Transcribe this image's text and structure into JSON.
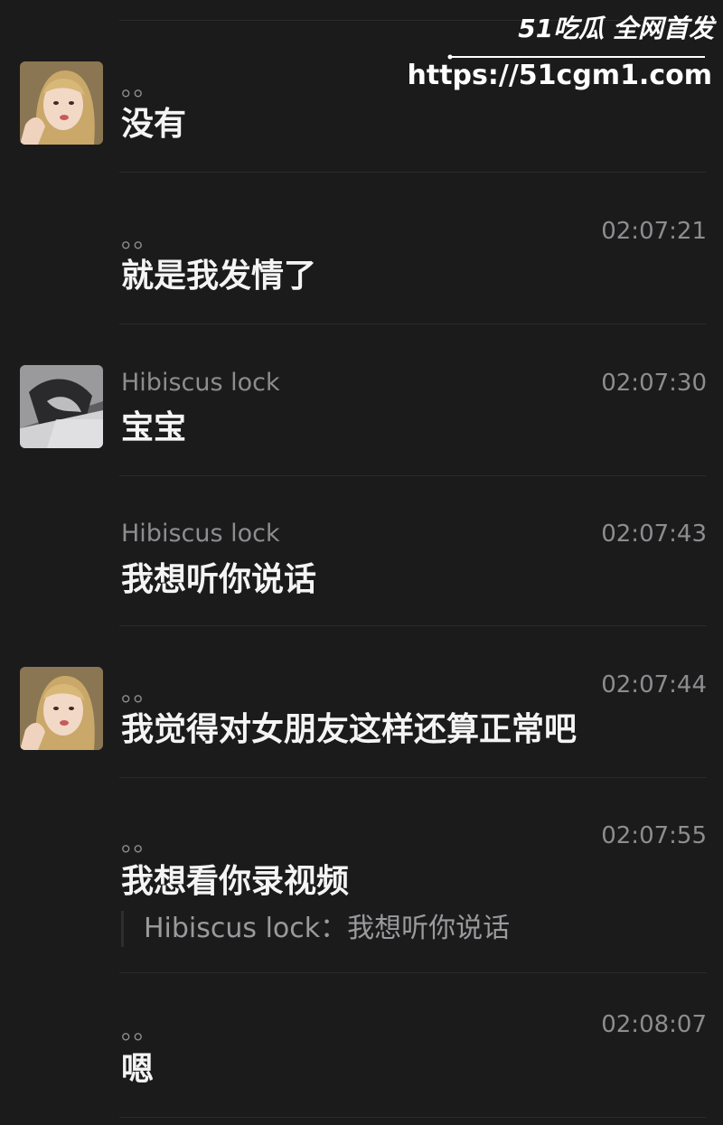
{
  "watermark": {
    "logo": "51吃瓜 全网首发",
    "url": "https://51cgm1.com"
  },
  "messages": [
    {
      "sender": "。。",
      "time": "",
      "text": "没有",
      "avatar": "female-avatar",
      "quote": ""
    },
    {
      "sender": "。。",
      "time": "02:07:21",
      "text": "就是我发情了",
      "avatar": "",
      "quote": ""
    },
    {
      "sender": "Hibiscus lock",
      "time": "02:07:30",
      "text": "宝宝",
      "avatar": "male-avatar",
      "quote": ""
    },
    {
      "sender": "Hibiscus lock",
      "time": "02:07:43",
      "text": "我想听你说话",
      "avatar": "",
      "quote": ""
    },
    {
      "sender": "。。",
      "time": "02:07:44",
      "text": "我觉得对女朋友这样还算正常吧",
      "avatar": "female-avatar",
      "quote": ""
    },
    {
      "sender": "。。",
      "time": "02:07:55",
      "text": "我想看你录视频",
      "avatar": "",
      "quote": "Hibiscus lock：我想听你说话"
    },
    {
      "sender": "。。",
      "time": "02:08:07",
      "text": "嗯",
      "avatar": "",
      "quote": ""
    }
  ]
}
